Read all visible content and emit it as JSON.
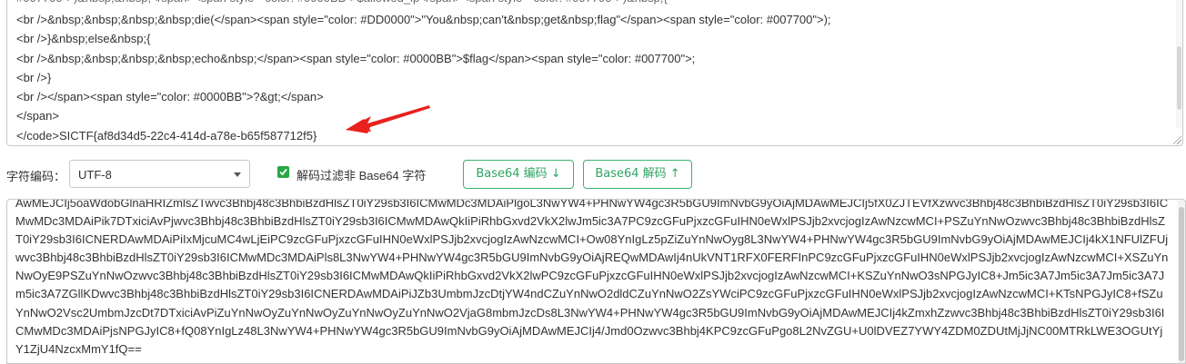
{
  "decoded": {
    "lines": [
      "#007700\">)&nbsp;&nbsp;</span><span style=\"color: #0000BB\">$allowed_ip</span><span style=\"color: #007700\">)&nbsp;{",
      "<br />&nbsp;&nbsp;&nbsp;&nbsp;die(</span><span style=\"color: #DD0000\">\"You&nbsp;can't&nbsp;get&nbsp;flag\"</span><span style=\"color: #007700\">);",
      "<br />}&nbsp;else&nbsp;{",
      "<br />&nbsp;&nbsp;&nbsp;&nbsp;echo&nbsp;</span><span style=\"color: #0000BB\">$flag</span><span style=\"color: #007700\">;",
      "<br />}",
      "<br /></span><span style=\"color: #0000BB\">?&gt;</span>",
      "</span>",
      "</code>SICTF{af8d34d5-22c4-414d-a78e-b65f587712f5}"
    ]
  },
  "toolbar": {
    "charset_label": "字符编码：",
    "charset_value": "UTF-8",
    "filter_label": "解码过滤非 Base64 字符",
    "filter_checked": true,
    "encode_button": "Base64 编码 ↓",
    "decode_button": "Base64 解码 ↑"
  },
  "base64": {
    "text": "AwMEJCIj5oaWdobGlnaHRIZmlsZTwvc3Bhbj48c3BhbiBzdHlsZT0iY29sb3I6ICMwMDc3MDAiPlgoL3NwYW4+PHNwYW4gc3R5bGU9ImNvbG9yOiAjMDAwMEJCIj5fX0ZJTEVfXzwvc3Bhbj48c3BhbiBzdHlsZT0iY29sb3I6ICMwMDc3MDAiPik7DTxiciAvPjwvc3Bhbj48c3BhbiBzdHlsZT0iY29sb3I6ICMwMDAwQkIiPiRhbGxvd2VkX2lwJm5ic3A7PC9zcGFuPjxzcGFuIHN0eWxlPSJjb2xvcjogIzAwNzcwMCI+PSZuYnNwOzwvc3Bhbj48c3BhbiBzdHlsZT0iY29sb3I6ICNERDAwMDAiPiIxMjcuMC4wLjEiPC9zcGFuPjxzcGFuIHN0eWxlPSJjb2xvcjogIzAwNzcwMCI+Ow08YnIgLz5pZiZuYnNwOyg8L3NwYW4+PHNwYW4gc3R5bGU9ImNvbG9yOiAjMDAwMEJCIj4kX1NFUlZFUjwvc3Bhbj48c3BhbiBzdHlsZT0iY29sb3I6ICMwMDc3MDAiPls8L3NwYW4+PHNwYW4gc3R5bGU9ImNvbG9yOiAjREQwMDAwIj4nUkVNT1RFX0FERFInPC9zcGFuPjxzcGFuIHN0eWxlPSJjb2xvcjogIzAwNzcwMCI+XSZuYnNwOyE9PSZuYnNwOzwvc3Bhbj48c3BhbiBzdHlsZT0iY29sb3I6ICMwMDAwQkIiPiRhbGxvd2VkX2lwPC9zcGFuPjxzcGFuIHN0eWxlPSJjb2xvcjogIzAwNzcwMCI+KSZuYnNwO3sNPGJyIC8+Jm5ic3A7Jm5ic3A7Jm5ic3A7Jm5ic3A7ZGllKDwvc3Bhbj48c3BhbiBzdHlsZT0iY29sb3I6ICNERDAwMDAiPiJZb3UmbmJzcDtjYW4ndCZuYnNwO2dldCZuYnNwO2ZsYWciPC9zcGFuPjxzcGFuIHN0eWxlPSJjb2xvcjogIzAwNzcwMCI+KTsNPGJyIC8+fSZuYnNwO2Vsc2UmbmJzcDt7DTxiciAvPiZuYnNwOyZuYnNwOyZuYnNwOyZuYnNwO2VjaG8mbmJzcDs8L3NwYW4+PHNwYW4gc3R5bGU9ImNvbG9yOiAjMDAwMEJCIj4kZmxhZzwvc3Bhbj48c3BhbiBzdHlsZT0iY29sb3I6ICMwMDc3MDAiPjsNPGJyIC8+fQ08YnIgLz48L3NwYW4+PHNwYW4gc3R5bGU9ImNvbG9yOiAjMDAwMEJCIj4/Jmd0Ozwvc3Bhbj4KPC9zcGFuPgo8L2NvZGU+U0lDVEZ7YWY4ZDM0ZDUtMjJjNC00MTRkLWE3OGUtYjY1ZjU4NzcxMmY1fQ=="
  },
  "colors": {
    "accent": "#28a745",
    "button_border": "#3cb371",
    "button_text": "#2fa462",
    "arrow": "#e8211d",
    "border": "#c8c8c8"
  },
  "icons": {
    "arrow": "red-annotation-arrow",
    "checkbox": "checkmark-icon",
    "select": "chevron-down-icon"
  }
}
